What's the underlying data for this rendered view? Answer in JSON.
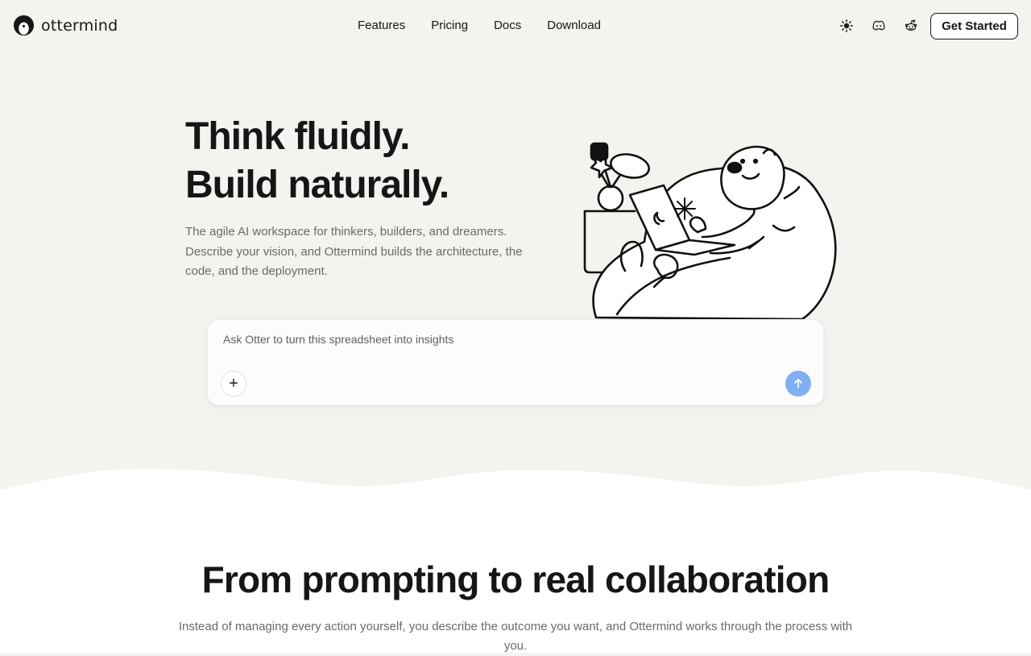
{
  "brand": {
    "name": "ottermind"
  },
  "nav": {
    "links": [
      "Features",
      "Pricing",
      "Docs",
      "Download"
    ],
    "icons": [
      "sun-icon",
      "discord-icon",
      "reddit-icon"
    ],
    "cta": "Get Started"
  },
  "hero": {
    "title_line1": "Think fluidly.",
    "title_line2": "Build naturally.",
    "subtitle": "The agile AI workspace for thinkers, builders, and dreamers. Describe your vision, and Ottermind builds the architecture, the code, and the deployment."
  },
  "prompt": {
    "placeholder": "Ask Otter to turn this spreadsheet into insights",
    "add_label": "+",
    "send_color": "#7fb0f2"
  },
  "section": {
    "title": "From prompting to real collaboration",
    "subtitle": "Instead of managing every action yourself, you describe the outcome you want, and Ottermind works through the process with you."
  },
  "colors": {
    "background": "#f3f3ef",
    "text": "#161616",
    "muted": "#6a6a6a",
    "accent": "#7fb0f2"
  }
}
